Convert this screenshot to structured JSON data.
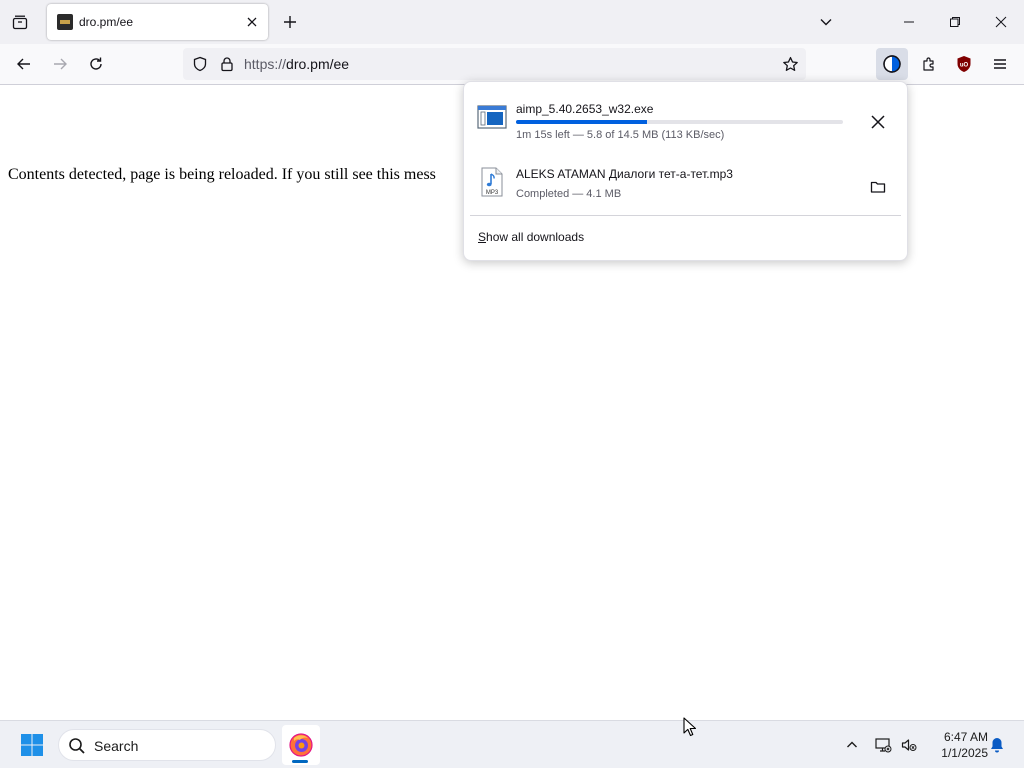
{
  "browser": {
    "tab": {
      "title": "dro.pm/ee"
    },
    "url": {
      "scheme": "https://",
      "host": "dro.pm/ee"
    }
  },
  "page": {
    "message": "Contents detected, page is being reloaded. If you still see this mess"
  },
  "downloads": {
    "items": [
      {
        "filename": "aimp_5.40.2653_w32.exe",
        "status": "1m 15s left — 5.8 of 14.5 MB (113 KB/sec)",
        "progress_percent": 40,
        "file_icon": "exe-file-icon",
        "action_icon": "cancel-icon"
      },
      {
        "filename": "ALEKS ATAMAN Диалоги тет-а-тет.mp3",
        "status": "Completed — 4.1 MB",
        "file_icon": "mp3-file-icon",
        "file_icon_label": "MP3",
        "action_icon": "folder-icon"
      }
    ],
    "show_all_label_accesskey": "S",
    "show_all_label_rest": "how all downloads"
  },
  "taskbar": {
    "search_label": "Search",
    "time": "6:47 AM",
    "date": "1/1/2025"
  },
  "colors": {
    "accent": "#0060df",
    "tabstrip_bg": "#f0f0f4",
    "ublock_red": "#800000"
  }
}
